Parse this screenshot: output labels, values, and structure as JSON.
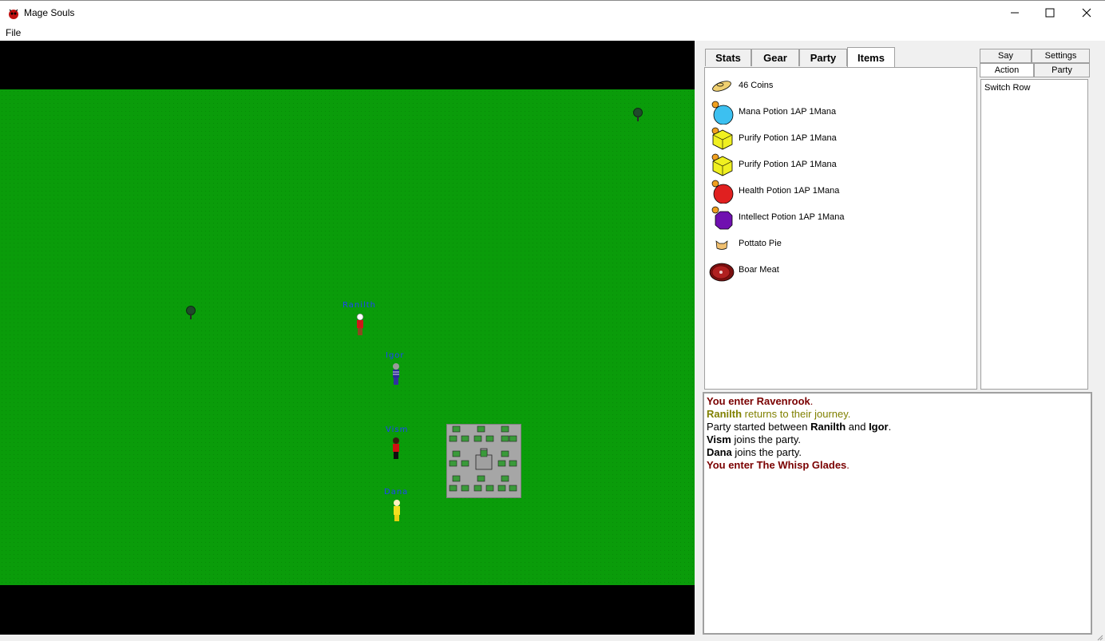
{
  "window": {
    "title": "Mage Souls",
    "minimize": "minimize",
    "maximize": "maximize",
    "close": "close"
  },
  "menu": {
    "file": "File"
  },
  "game": {
    "characters": [
      {
        "name": "Ranilth"
      },
      {
        "name": "Igor"
      },
      {
        "name": "Vism"
      },
      {
        "name": "Dana"
      }
    ]
  },
  "tabs": [
    "Stats",
    "Gear",
    "Party",
    "Items"
  ],
  "active_tab": "Items",
  "items": [
    {
      "label": "46 Coins",
      "icon": "coins-icon"
    },
    {
      "label": "Mana Potion 1AP 1Mana",
      "icon": "mana-potion-icon",
      "color": "#3cc0f0"
    },
    {
      "label": "Purify Potion 1AP 1Mana",
      "icon": "purify-potion-icon",
      "color": "#f0f020"
    },
    {
      "label": "Purify Potion 1AP 1Mana",
      "icon": "purify-potion-icon",
      "color": "#f0f020"
    },
    {
      "label": "Health Potion 1AP 1Mana",
      "icon": "health-potion-icon",
      "color": "#e02020"
    },
    {
      "label": "Intellect Potion 1AP 1Mana",
      "icon": "intellect-potion-icon",
      "color": "#7010b0"
    },
    {
      "label": "Pottato Pie",
      "icon": "pie-icon"
    },
    {
      "label": "Boar Meat",
      "icon": "meat-icon"
    }
  ],
  "action_tabs": {
    "say": "Say",
    "settings": "Settings",
    "action": "Action",
    "party": "Party"
  },
  "actions": [
    "Switch Row"
  ],
  "log": {
    "l1a": "You enter Ravenrook",
    "l1b": ".",
    "l2a": "Ranilth",
    "l2b": " returns to their journey.",
    "l3a": "Party started between ",
    "l3b": "Ranilth",
    "l3c": " and ",
    "l3d": "Igor",
    "l3e": ".",
    "l4a": "Vism",
    "l4b": " joins the party.",
    "l5a": "Dana",
    "l5b": " joins the party.",
    "l6a": "You enter The Whisp Glades",
    "l6b": "."
  }
}
